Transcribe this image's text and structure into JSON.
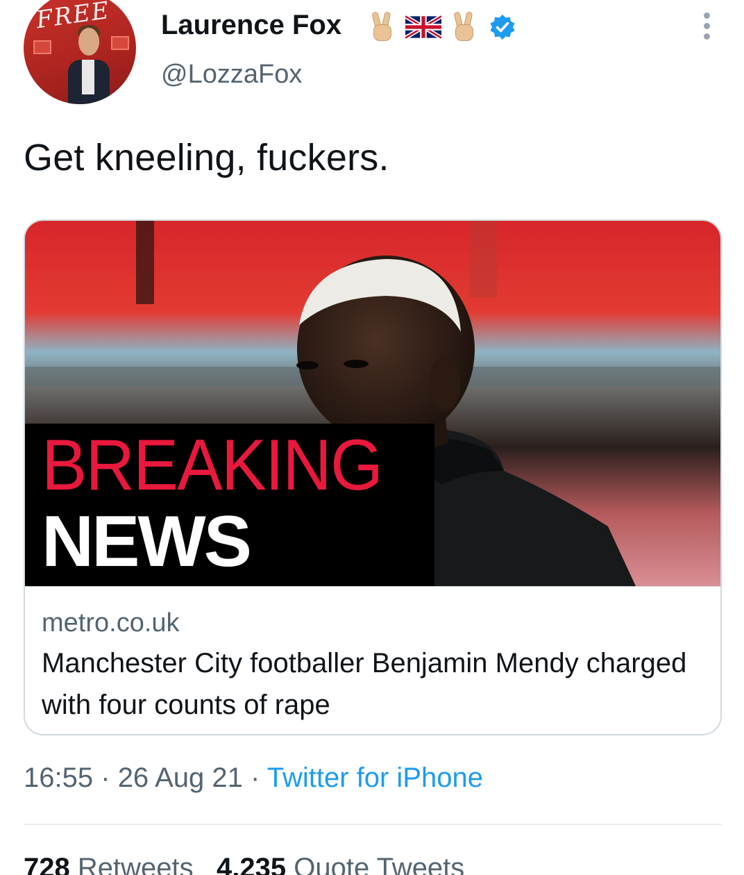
{
  "author": {
    "display_name": "Laurence Fox",
    "handle": "@LozzaFox",
    "avatar_text": "FREE",
    "name_emojis": [
      "victory-hand",
      "uk-flag",
      "victory-hand"
    ],
    "verified": true
  },
  "tweet": {
    "text": "Get kneeling, fuckers."
  },
  "card": {
    "image_caption_line1": "BREAKING",
    "image_caption_line2": "NEWS",
    "domain": "metro.co.uk",
    "title": "Manchester City footballer Benjamin Mendy charged with four counts of rape"
  },
  "meta": {
    "time": "16:55",
    "separator": "·",
    "date": "26 Aug 21",
    "source": "Twitter for iPhone"
  },
  "stats": {
    "retweets_count": "728",
    "retweets_label": "Retweets",
    "quotes_count": "4,235",
    "quotes_label": "Quote Tweets"
  },
  "colors": {
    "accent": "#1d9bf0",
    "secondary_text": "#536471",
    "breaking_red": "#e8193d"
  }
}
